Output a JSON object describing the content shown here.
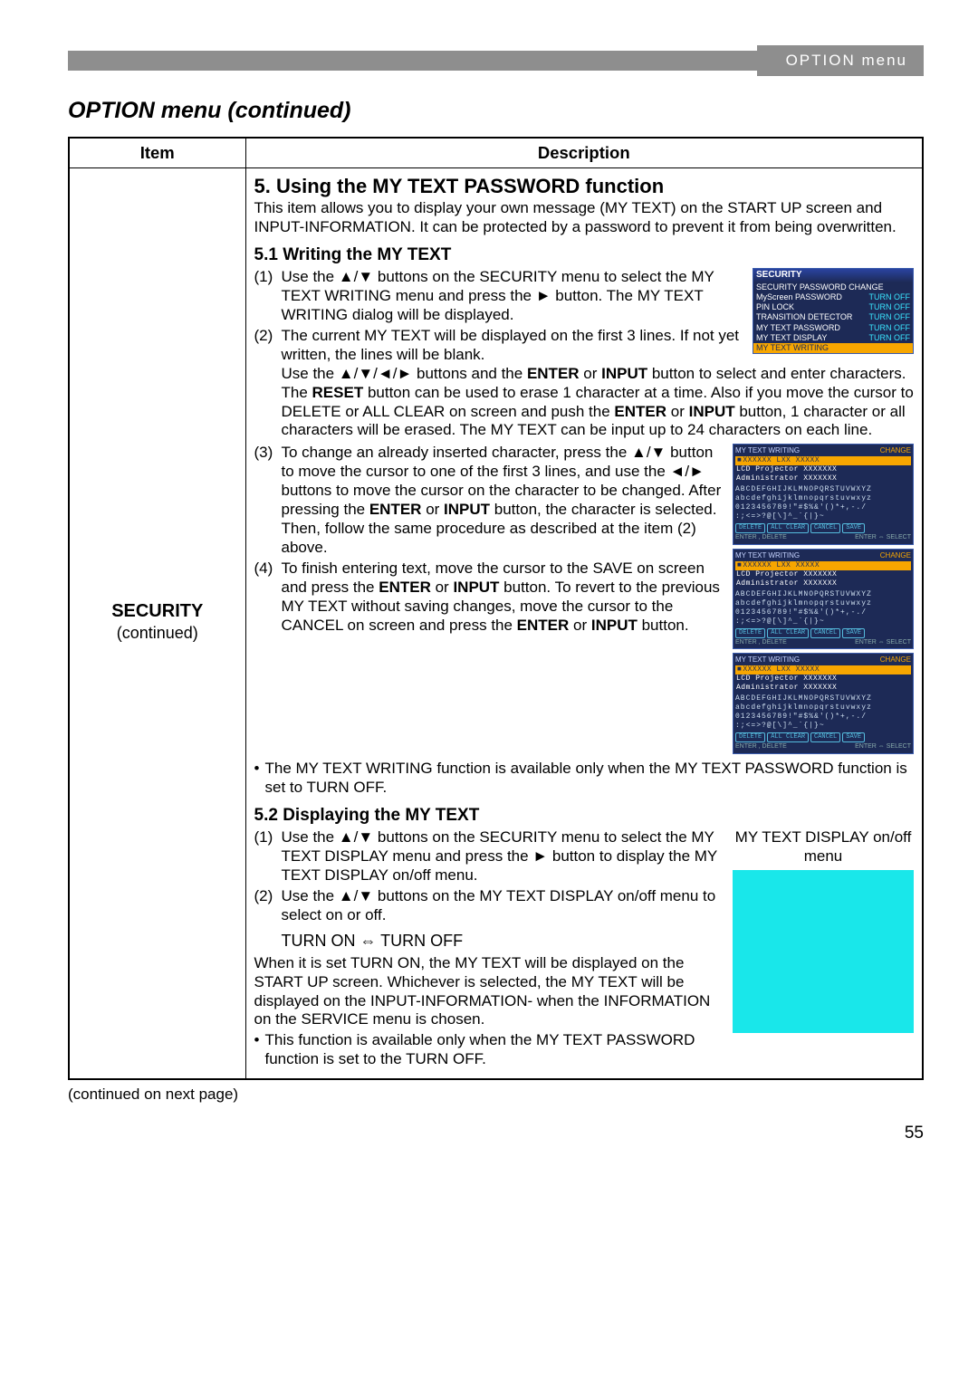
{
  "header": {
    "tab": "OPTION menu"
  },
  "page_title": "OPTION menu (continued)",
  "table": {
    "headers": {
      "item": "Item",
      "desc": "Description"
    },
    "item": {
      "name": "SECURITY",
      "sub": "(continued)"
    },
    "sec5": {
      "title": "5. Using the MY TEXT PASSWORD function",
      "intro": "This item allows you to display your own message (MY TEXT) on the START UP screen and INPUT-INFORMATION. It can be protected by a password to prevent it from being overwritten.",
      "s51": {
        "title": "5.1 Writing the MY TEXT",
        "step1_num": "(1)",
        "step1": "Use the ▲/▼ buttons on the SECURITY menu to select the MY TEXT WRITING menu and press the ► button. The MY TEXT WRITING dialog will be displayed.",
        "step2_num": "(2)",
        "step2a": "The current MY TEXT will be displayed on the first 3 lines. If not yet written, the lines will be blank.",
        "step2b_pre": "Use the ▲/▼/◄/► buttons and the ",
        "step2b_enter": "ENTER",
        "step2b_or": " or ",
        "step2b_input": "INPUT",
        "step2b_post": " button to select and enter characters. The ",
        "step2b_reset": "RESET",
        "step2b_post2": " button can be used to erase 1 character at a time. Also if you move the cursor to DELETE or ALL CLEAR on screen and push the ",
        "step2b_enter2": "ENTER",
        "step2b_post3": " or ",
        "step2b_input2": "INPUT",
        "step2b_post4": " button, 1 character or all characters will be erased. The MY TEXT can be input up to 24 characters on each line.",
        "step3_num": "(3)",
        "step3a": "To change an already inserted character, press the ▲/▼ button to move the cursor to one of the first 3 lines, and use the ◄/► buttons to move the cursor on the character to be changed. After pressing the ",
        "step3_enter": "ENTER",
        "step3_or": " or ",
        "step3_input": "INPUT",
        "step3b": " button, the character is selected. Then, follow the same procedure as described at the item (2) above.",
        "step4_num": "(4)",
        "step4a": "To finish entering text, move the cursor to the SAVE on screen and press the ",
        "step4_enter": "ENTER",
        "step4_or": " or ",
        "step4_input": "INPUT",
        "step4b": " button. To revert to the previous MY TEXT without saving changes, move the cursor to the CANCEL on screen and press the ",
        "step4_enter2": "ENTER",
        "step4_or2": " or ",
        "step4_input2": "INPUT",
        "step4c": " button.",
        "note": "The MY TEXT WRITING function is available only when the MY TEXT PASSWORD function is set to TURN OFF."
      },
      "s52": {
        "title": "5.2 Displaying the MY TEXT",
        "step1_num": "(1)",
        "step1": "Use the ▲/▼ buttons on the SECURITY menu to select the MY TEXT DISPLAY menu and press the ► button to display the MY TEXT DISPLAY on/off menu.",
        "step2_num": "(2)",
        "step2": "Use the ▲/▼ buttons on the MY TEXT DISPLAY on/off menu to select on or off.",
        "toggle": "TURN ON ⇔ TURN OFF",
        "explain": "When it is set TURN ON, the MY TEXT will be displayed on the START UP screen. Whichever is selected, the MY TEXT will be displayed on the INPUT-INFORMATION- when the INFORMATION on the SERVICE menu is chosen.",
        "note": "This function is available only when the MY TEXT PASSWORD function is set to the TURN OFF.",
        "caption": "MY TEXT DISPLAY on/off menu"
      }
    }
  },
  "security_menu": {
    "title": "SECURITY",
    "rows": [
      {
        "label": "SECURITY PASSWORD CHANGE",
        "val": ""
      },
      {
        "label": "MyScreen PASSWORD",
        "val": "TURN OFF"
      },
      {
        "label": "PIN LOCK",
        "val": "TURN OFF"
      },
      {
        "label": "TRANSITION DETECTOR",
        "val": "TURN OFF"
      },
      {
        "label": "MY TEXT PASSWORD",
        "val": "TURN OFF"
      },
      {
        "label": "MY TEXT DISPLAY",
        "val": "TURN OFF"
      }
    ],
    "highlight": "MY TEXT WRITING"
  },
  "char_dialogs": {
    "top_left": "MY TEXT WRITING",
    "top_right": "CHANGE",
    "line_a": "XXXXXX    LXX    XXXXX",
    "line_b": "LCD Projector XXXXXXX",
    "line_c": "Administrator XXXXXXX",
    "grid1": "ABCDEFGHIJKLMNOPQRSTUVWXYZ",
    "grid2": "abcdefghijklmnopqrstuvwxyz",
    "grid3": "0123456789!\"#$%&'()*+,-./",
    "grid4": ":;<=>?@[\\]^_`{|}~",
    "btn_delete": "DELETE",
    "btn_allclear": "ALL CLEAR",
    "btn_cancel": "CANCEL",
    "btn_save": "SAVE",
    "foot_left": "ENTER , DELETE",
    "foot_right": "ENTER ⇔ SELECT"
  },
  "cont": "(continued on next page)",
  "page_num": "55"
}
